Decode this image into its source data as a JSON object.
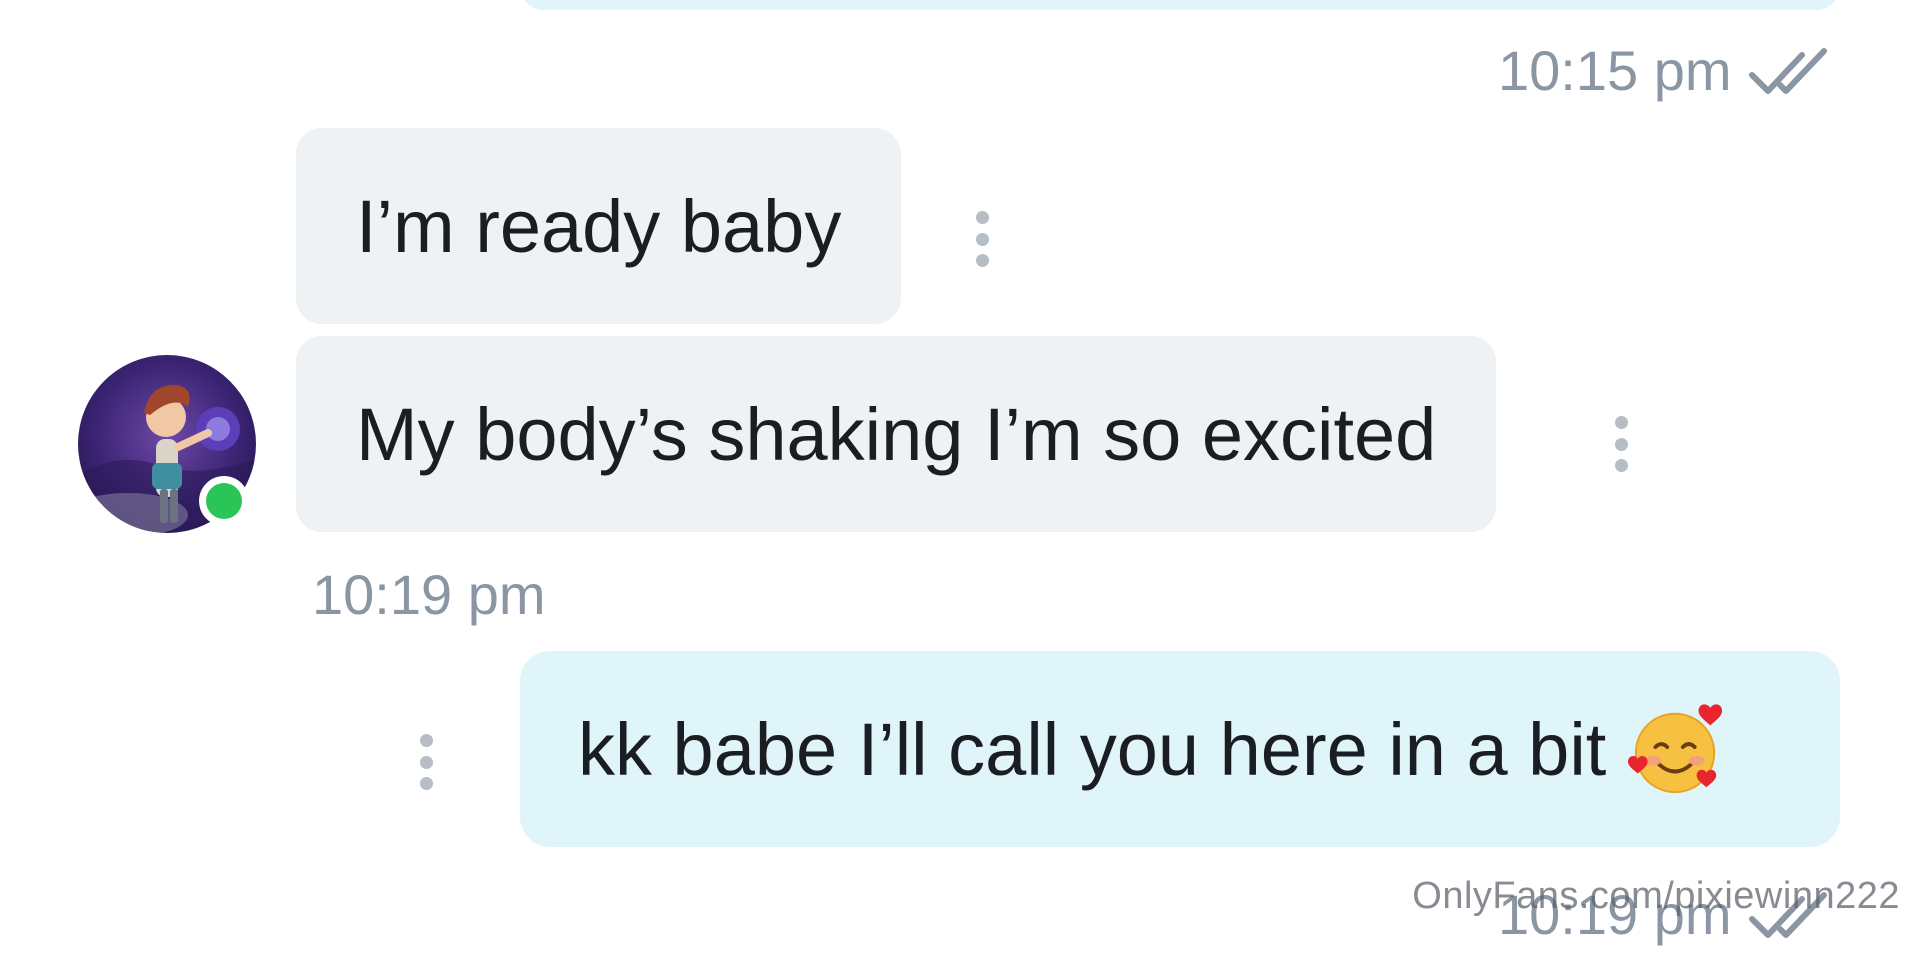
{
  "conversation": {
    "previous_outgoing": {
      "time": "10:15 pm",
      "status_icon": "double-check-icon"
    },
    "incoming": {
      "messages": [
        {
          "text": "I’m ready baby"
        },
        {
          "text": "My body’s shaking I’m so excited"
        }
      ],
      "time": "10:19 pm",
      "sender_online": true
    },
    "outgoing": {
      "text": "kk babe I’ll call you here in a bit",
      "emoji": "smiling-face-with-hearts-icon",
      "time": "10:19 pm",
      "status_icon": "double-check-icon"
    }
  },
  "watermark": "OnlyFans.com/pixiewinn222",
  "colors": {
    "incoming_bubble": "#eef2f4",
    "outgoing_bubble": "#dff5fa",
    "timestamp": "#8a96a3",
    "online_dot": "#2bc457",
    "menu_dots": "#b6bdc4"
  }
}
